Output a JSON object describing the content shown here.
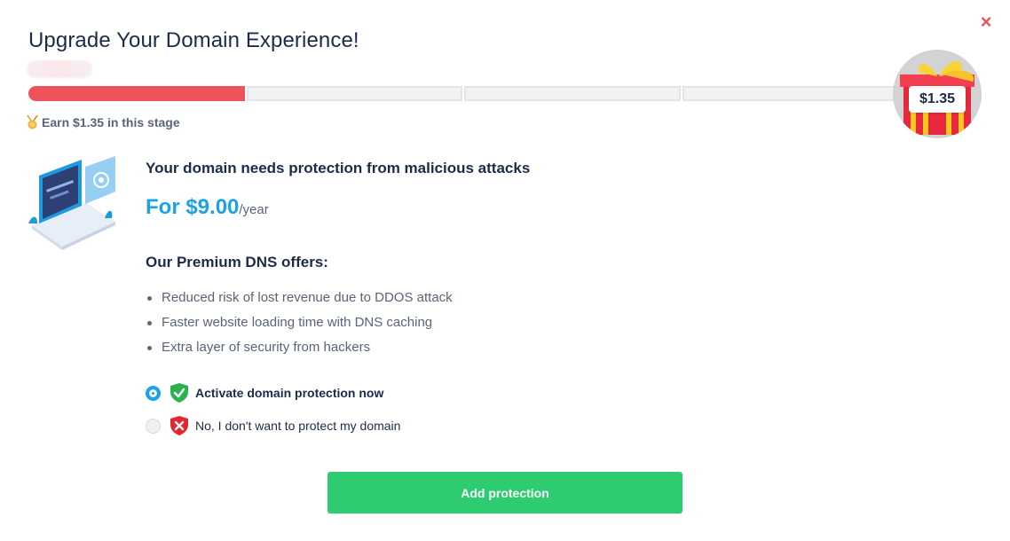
{
  "dialog": {
    "title": "Upgrade Your Domain Experience!",
    "close_label": "×"
  },
  "progress": {
    "stages_total": 4,
    "stages_completed": 1,
    "earn_text": "Earn $1.35 in this stage",
    "reward_amount": "$1.35",
    "filled_color": "#ef525a"
  },
  "offer": {
    "headline": "Your domain needs protection from malicious attacks",
    "price": "For $9.00",
    "price_period": "/year",
    "accent_color": "#1aa3e8"
  },
  "features": {
    "title": "Our Premium DNS offers:",
    "items": [
      "Reduced risk of lost revenue due to DDOS attack",
      "Faster website loading time with DNS caching",
      "Extra layer of security from hackers"
    ]
  },
  "options": [
    {
      "label": "Activate domain protection now",
      "selected": true,
      "icon": "shield-check-icon"
    },
    {
      "label": "No, I don't want to protect my domain",
      "selected": false,
      "icon": "shield-x-icon"
    }
  ],
  "cta": {
    "label": "Add protection",
    "color": "#2ecc71"
  }
}
